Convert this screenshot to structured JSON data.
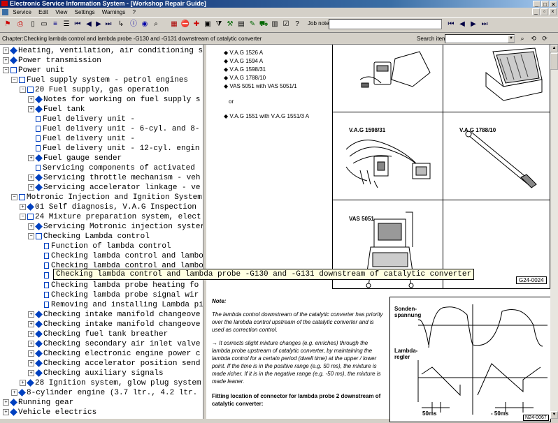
{
  "window": {
    "title": "Electronic Service Information System - [Workshop Repair Guide]"
  },
  "menu": [
    "Service",
    "Edit",
    "View",
    "Settings",
    "Warnings",
    "?"
  ],
  "toolbar": {
    "job_note_label": "Job note:",
    "job_note_value": ""
  },
  "chapter": {
    "label": "Chapter:Checking lambda control and lambda probe -G130 and -G131 downstream of catalytic converter"
  },
  "search": {
    "label": "Search item:",
    "value": ""
  },
  "tree": [
    {
      "label": "Heating, ventilation, air conditioning s",
      "level": 0,
      "icon": "book-closed",
      "expander": "+"
    },
    {
      "label": "Power transmission",
      "level": 0,
      "icon": "book-closed",
      "expander": "+"
    },
    {
      "label": "Power unit",
      "level": 0,
      "icon": "book-open",
      "expander": "-"
    },
    {
      "label": "Fuel supply system - petrol engines",
      "level": 1,
      "icon": "book-open",
      "expander": "-"
    },
    {
      "label": "20 Fuel supply, gas operation",
      "level": 2,
      "icon": "book-open",
      "expander": "-"
    },
    {
      "label": "Notes for working on fuel supply s",
      "level": 3,
      "icon": "book-closed",
      "expander": "+"
    },
    {
      "label": "Fuel tank",
      "level": 3,
      "icon": "book-closed",
      "expander": "+"
    },
    {
      "label": "Fuel delivery unit -",
      "level": 3,
      "icon": "page",
      "expander": ""
    },
    {
      "label": "Fuel delivery unit - 6-cyl. and 8-",
      "level": 3,
      "icon": "page",
      "expander": ""
    },
    {
      "label": "Fuel delivery unit -",
      "level": 3,
      "icon": "page",
      "expander": ""
    },
    {
      "label": "Fuel delivery unit - 12-cyl. engin",
      "level": 3,
      "icon": "page",
      "expander": ""
    },
    {
      "label": "Fuel gauge sender",
      "level": 3,
      "icon": "book-closed",
      "expander": "+"
    },
    {
      "label": "Servicing components of activated",
      "level": 3,
      "icon": "page",
      "expander": ""
    },
    {
      "label": "Servicing throttle mechanism - veh",
      "level": 3,
      "icon": "book-closed",
      "expander": "+"
    },
    {
      "label": "Servicing accelerator linkage - ve",
      "level": 3,
      "icon": "book-closed",
      "expander": "+"
    },
    {
      "label": "Motronic Injection and Ignition System",
      "level": 1,
      "icon": "book-open",
      "expander": "-"
    },
    {
      "label": "01 Self diagnosis, V.A.G Inspection",
      "level": 2,
      "icon": "book-closed",
      "expander": "+"
    },
    {
      "label": "24 Mixture preparation system, elect",
      "level": 2,
      "icon": "book-open",
      "expander": "-"
    },
    {
      "label": "Servicing Motronic injection syster",
      "level": 3,
      "icon": "book-closed",
      "expander": "+"
    },
    {
      "label": "Checking Lambda control",
      "level": 3,
      "icon": "book-open",
      "expander": "-"
    },
    {
      "label": "Function of lambda control",
      "level": 4,
      "icon": "page",
      "expander": ""
    },
    {
      "label": "Checking lambda control and lambo",
      "level": 4,
      "icon": "page",
      "expander": ""
    },
    {
      "label": "Checking lambda control and lambo",
      "level": 4,
      "icon": "page",
      "expander": ""
    },
    {
      "label": "",
      "level": 4,
      "icon": "page",
      "expander": ""
    },
    {
      "label": "Checking lambda probe heating fo",
      "level": 4,
      "icon": "page",
      "expander": ""
    },
    {
      "label": "Checking lambda probe signal wir",
      "level": 4,
      "icon": "page",
      "expander": ""
    },
    {
      "label": "Removing and installing Lambda pi",
      "level": 4,
      "icon": "page",
      "expander": ""
    },
    {
      "label": "Checking intake manifold changeove",
      "level": 3,
      "icon": "book-closed",
      "expander": "+"
    },
    {
      "label": "Checking intake manifold changeove",
      "level": 3,
      "icon": "book-closed",
      "expander": "+"
    },
    {
      "label": "Checking fuel tank breather",
      "level": 3,
      "icon": "book-closed",
      "expander": "+"
    },
    {
      "label": "Checking secondary air inlet valve",
      "level": 3,
      "icon": "book-closed",
      "expander": "+"
    },
    {
      "label": "Checking electronic engine power c",
      "level": 3,
      "icon": "book-closed",
      "expander": "+"
    },
    {
      "label": "Checking accelerator position send",
      "level": 3,
      "icon": "book-closed",
      "expander": "+"
    },
    {
      "label": "Checking auxiliary signals",
      "level": 3,
      "icon": "book-closed",
      "expander": "+"
    },
    {
      "label": "28 Ignition system, glow plug system",
      "level": 2,
      "icon": "book-closed",
      "expander": "+"
    },
    {
      "label": "8-cylinder engine (3.7 ltr., 4.2 ltr.",
      "level": 1,
      "icon": "book-closed",
      "expander": "+"
    },
    {
      "label": "Running gear",
      "level": 0,
      "icon": "book-closed",
      "expander": "+"
    },
    {
      "label": "Vehicle electrics",
      "level": 0,
      "icon": "book-closed",
      "expander": "+"
    }
  ],
  "selected_item": "Checking lambda control and lambda probe -G130 and -G131 downstream of catalytic converter",
  "content": {
    "tools": [
      "V.A.G 1526 A",
      "V.A.G 1594 A",
      "V.A.G 1598/31",
      "V.A.G 1788/10",
      "VAS 5051 with VAS 5051/1"
    ],
    "or": "or",
    "alt_tool": "V.A.G 1551 with V.A.G 1551/3 A",
    "fig_labels": {
      "vag1598": "V.A.G 1598/31",
      "vag1788": "V.A.G 1788/10",
      "vas5051": "VAS 5051",
      "figcode": "G24-0024"
    },
    "note_title": "Note:",
    "note_p1": "The lambda control downstream of the catalytic converter has priority over the lambda control upstream of the catalytic converter and is used as correction control.",
    "note_p2": "→ It corrects slight mixture changes (e.g. enriches) through the lambda probe upstream of catalytic converter, by maintaining the lambda control for a certain period (dwell time) at the upper / lower point. If the time is in the positive range (e.g. 50 ms), the mixture is made richer. If it is in the negative range (e.g. -50 ms), the mixture is made leaner.",
    "fitting_title": "Fitting location of connector for lambda probe 2 downstream of catalytic converter:",
    "diagram": {
      "label_voltage_1": "Sonden-",
      "label_voltage_2": "spannung",
      "label_reg_1": "Lambda-",
      "label_reg_2": "regler",
      "time_pos": "50ms",
      "time_neg": "- 50ms",
      "code": "N24-0067"
    }
  }
}
